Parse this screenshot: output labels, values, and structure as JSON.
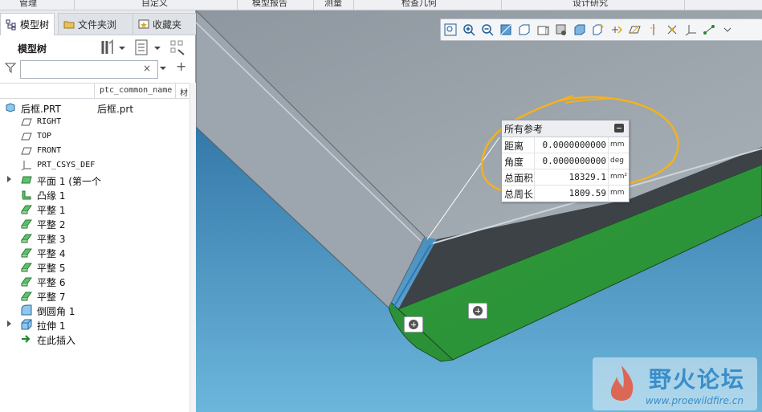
{
  "ribbon": {
    "groups": [
      "管理",
      "自定义",
      "模型报告",
      "测量",
      "检查几何",
      "设计研究"
    ]
  },
  "left_panel": {
    "tabs": [
      {
        "label": "模型树",
        "active": true,
        "icon": "model-tree-icon"
      },
      {
        "label": "文件夹浏",
        "active": false,
        "icon": "folder-browser-icon"
      },
      {
        "label": "收藏夹",
        "active": false,
        "icon": "favorites-icon"
      }
    ],
    "tree_title": "模型树",
    "filter_placeholder": "",
    "filter_clear": "×",
    "columns": [
      "ptc_common_name",
      "材"
    ],
    "tree": [
      {
        "label": "后框.PRT",
        "value": "后框.prt",
        "icon": "part-icon",
        "expandable": false,
        "level": 0,
        "mono": true
      },
      {
        "label": "RIGHT",
        "icon": "datum-plane-icon",
        "level": 1,
        "mono": true
      },
      {
        "label": "TOP",
        "icon": "datum-plane-icon",
        "level": 1,
        "mono": true
      },
      {
        "label": "FRONT",
        "icon": "datum-plane-icon",
        "level": 1,
        "mono": true
      },
      {
        "label": "PRT_CSYS_DEF",
        "icon": "csys-icon",
        "level": 1,
        "mono": true
      },
      {
        "label": "平面 1 (第一个",
        "icon": "planar-wall-icon",
        "level": 1,
        "expandable": true
      },
      {
        "label": "凸缘 1",
        "icon": "flange-icon",
        "level": 1
      },
      {
        "label": "平整 1",
        "icon": "flat-wall-icon",
        "level": 1
      },
      {
        "label": "平整 2",
        "icon": "flat-wall-icon",
        "level": 1
      },
      {
        "label": "平整 3",
        "icon": "flat-wall-icon",
        "level": 1
      },
      {
        "label": "平整 4",
        "icon": "flat-wall-icon",
        "level": 1
      },
      {
        "label": "平整 5",
        "icon": "flat-wall-icon",
        "level": 1
      },
      {
        "label": "平整 6",
        "icon": "flat-wall-icon",
        "level": 1
      },
      {
        "label": "平整 7",
        "icon": "flat-wall-icon",
        "level": 1
      },
      {
        "label": "倒圆角 1",
        "icon": "round-icon",
        "level": 1
      },
      {
        "label": "拉伸 1",
        "icon": "extrude-icon",
        "level": 1,
        "expandable": true
      },
      {
        "label": "在此插入",
        "icon": "insert-here-icon",
        "level": 1
      }
    ]
  },
  "viewport": {
    "toolbar_icons": [
      "refit-icon",
      "zoom-in-icon",
      "zoom-out-icon",
      "repaint-icon",
      "display-style-icon",
      "saved-views-icon",
      "perspective-icon",
      "section-icon",
      "annotation-display-icon",
      "datum-display-icon",
      "plane-display-icon",
      "axis-display-icon",
      "point-display-icon",
      "csys-display-icon",
      "spin-center-icon",
      "more-icon"
    ],
    "measure_panel": {
      "title": "所有参考",
      "rows": [
        {
          "key": "距离",
          "value": "0.0000000000",
          "unit": "mm"
        },
        {
          "key": "角度",
          "value": "0.0000000000",
          "unit": "deg"
        },
        {
          "key": "总面积",
          "value": "18329.1",
          "unit": "mm²"
        },
        {
          "key": "总周长",
          "value": "1809.59",
          "unit": "mm"
        }
      ]
    },
    "watermark": {
      "title": "野火论坛",
      "url": "www.proewildfire.cn"
    },
    "colors": {
      "background_top": "#1e5f94",
      "background_bottom": "#6cb6dc",
      "part_face": "#9ea7af",
      "part_edge_face": "#3d4247",
      "flange_green": "#2e9a3a",
      "annotation_ellipse": "#f2b21f"
    }
  }
}
